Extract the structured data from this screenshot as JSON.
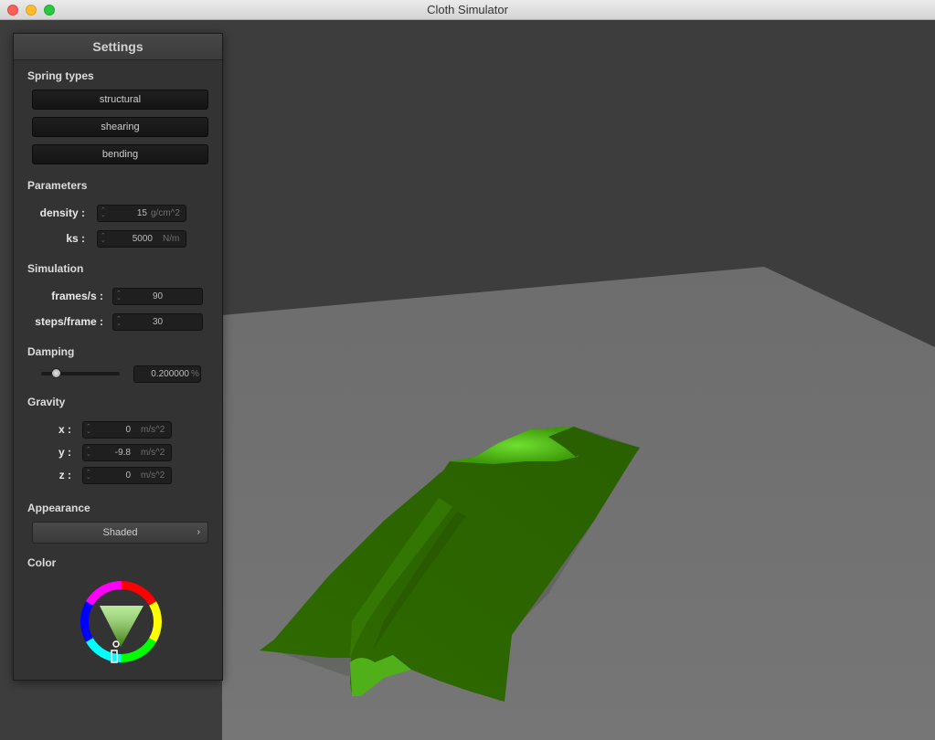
{
  "window": {
    "title": "Cloth Simulator"
  },
  "settings": {
    "title": "Settings",
    "spring_types": {
      "heading": "Spring types",
      "buttons": [
        "structural",
        "shearing",
        "bending"
      ]
    },
    "parameters": {
      "heading": "Parameters",
      "density": {
        "label": "density :",
        "value": "15",
        "unit": "g/cm^2"
      },
      "ks": {
        "label": "ks :",
        "value": "5000",
        "unit": "N/m"
      }
    },
    "simulation": {
      "heading": "Simulation",
      "frames": {
        "label": "frames/s :",
        "value": "90"
      },
      "steps": {
        "label": "steps/frame :",
        "value": "30"
      }
    },
    "damping": {
      "heading": "Damping",
      "value": "0.200000",
      "unit": "%",
      "slider_fraction": 0.2
    },
    "gravity": {
      "heading": "Gravity",
      "x": {
        "label": "x :",
        "value": "0",
        "unit": "m/s^2"
      },
      "y": {
        "label": "y :",
        "value": "-9.8",
        "unit": "m/s^2"
      },
      "z": {
        "label": "z :",
        "value": "0",
        "unit": "m/s^2"
      }
    },
    "appearance": {
      "heading": "Appearance",
      "value": "Shaded",
      "chevron": "›"
    },
    "color": {
      "heading": "Color",
      "selected": "#2e6a00"
    }
  },
  "scene": {
    "background": "#3d3d3d",
    "floor": "#6b6b6b",
    "cloth": "#2e6a00",
    "cloth_highlight": "#58d41c"
  }
}
